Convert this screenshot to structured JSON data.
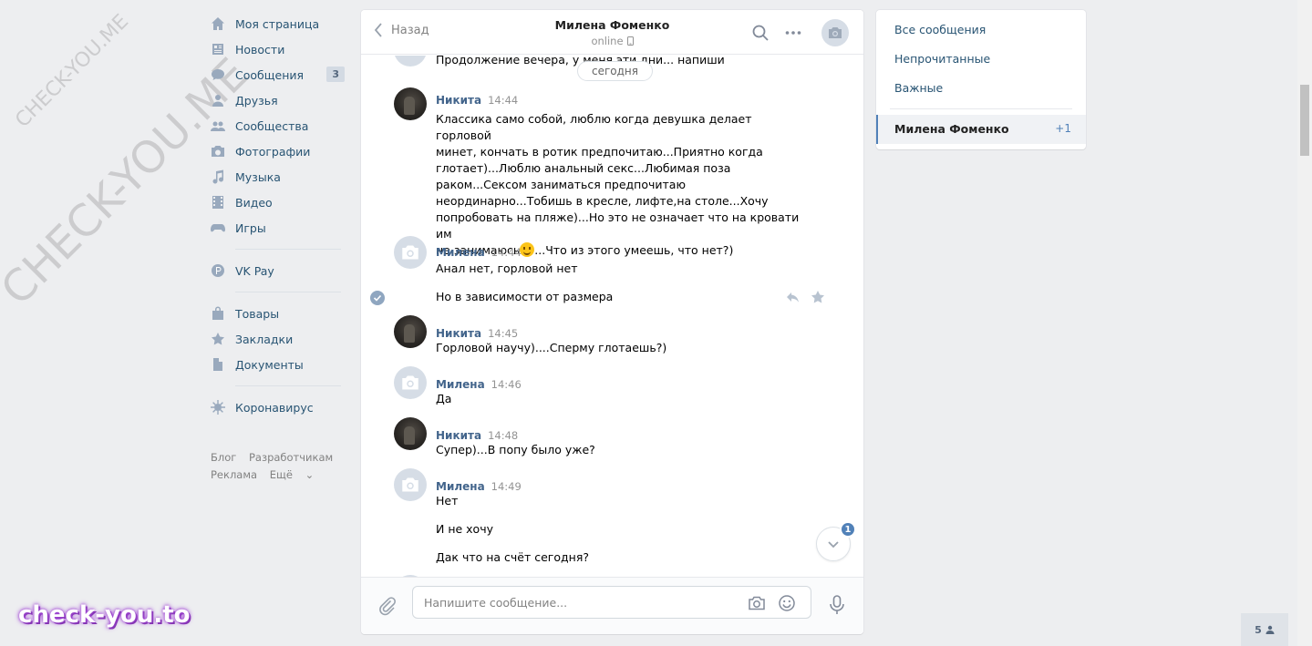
{
  "watermarks": {
    "diag_small": "CHECK-YOU.ME",
    "diag_big": "CHECK-YOU.ME",
    "brand": "check-you.to"
  },
  "sidebar": {
    "items": [
      {
        "label": "Моя страница",
        "icon": "home-icon"
      },
      {
        "label": "Новости",
        "icon": "news-icon"
      },
      {
        "label": "Сообщения",
        "icon": "messages-icon",
        "badge": "3"
      },
      {
        "label": "Друзья",
        "icon": "friends-icon"
      },
      {
        "label": "Сообщества",
        "icon": "groups-icon"
      },
      {
        "label": "Фотографии",
        "icon": "photos-icon"
      },
      {
        "label": "Музыка",
        "icon": "music-icon"
      },
      {
        "label": "Видео",
        "icon": "video-icon"
      },
      {
        "label": "Игры",
        "icon": "games-icon"
      },
      {
        "label": "VK Pay",
        "icon": "vkpay-icon"
      },
      {
        "label": "Товары",
        "icon": "market-icon"
      },
      {
        "label": "Закладки",
        "icon": "bookmarks-icon"
      },
      {
        "label": "Документы",
        "icon": "docs-icon"
      },
      {
        "label": "Коронавирус",
        "icon": "virus-icon"
      }
    ],
    "footer": [
      "Блог",
      "Разработчикам",
      "Реклама",
      "Ещё"
    ]
  },
  "chat": {
    "back_label": "Назад",
    "peer_name": "Милена Фоменко",
    "peer_status": "online",
    "date_pill": "сегодня",
    "top_cut_text": "Продолжение вечера, у меня эти дни... напиши",
    "messages": [
      {
        "author": "Никита",
        "time": "14:44",
        "lines": [
          "Классика само собой, люблю когда девушка делает горловой",
          "минет, кончать в ротик предпочитаю...Приятно когда",
          "глотает)...Люблю анальный секс...Любимая поза",
          "раком...Сексом заниматься предпочитаю",
          "неординарно...Тобишь в кресле, лифте,на столе...Хочу",
          "попробовать на пляже)...Но это не означает что на кровати им",
          "не занимаюсь",
          "...Что из этого умеешь, что нет?)"
        ]
      },
      {
        "author": "Милена",
        "time": "14:44",
        "lines": [
          "Анал нет, горловой нет"
        ]
      },
      {
        "extra": "Но в зависимости от размера"
      },
      {
        "author": "Никита",
        "time": "14:45",
        "lines": [
          "Горловой научу)....Сперму глотаешь?)"
        ]
      },
      {
        "author": "Милена",
        "time": "14:46",
        "lines": [
          "Да"
        ]
      },
      {
        "author": "Никита",
        "time": "14:48",
        "lines": [
          "Супер)...В попу было уже?"
        ]
      },
      {
        "author": "Милена",
        "time": "14:49",
        "lines": [
          "Нет"
        ]
      },
      {
        "extra": "И не хочу"
      },
      {
        "extra": "Дак что на счёт сегодня?"
      }
    ],
    "scroll_badge": "1",
    "composer_placeholder": "Напишите сообщение..."
  },
  "right_panel": {
    "filters": [
      "Все сообщения",
      "Непрочитанные",
      "Важные"
    ],
    "active_chat": {
      "name": "Милена Фоменко",
      "count": "+1"
    }
  },
  "online_count": "5",
  "colors": {
    "link": "#285473",
    "accent": "#5181b8",
    "author": "#42648b",
    "bg": "#edeef0"
  }
}
